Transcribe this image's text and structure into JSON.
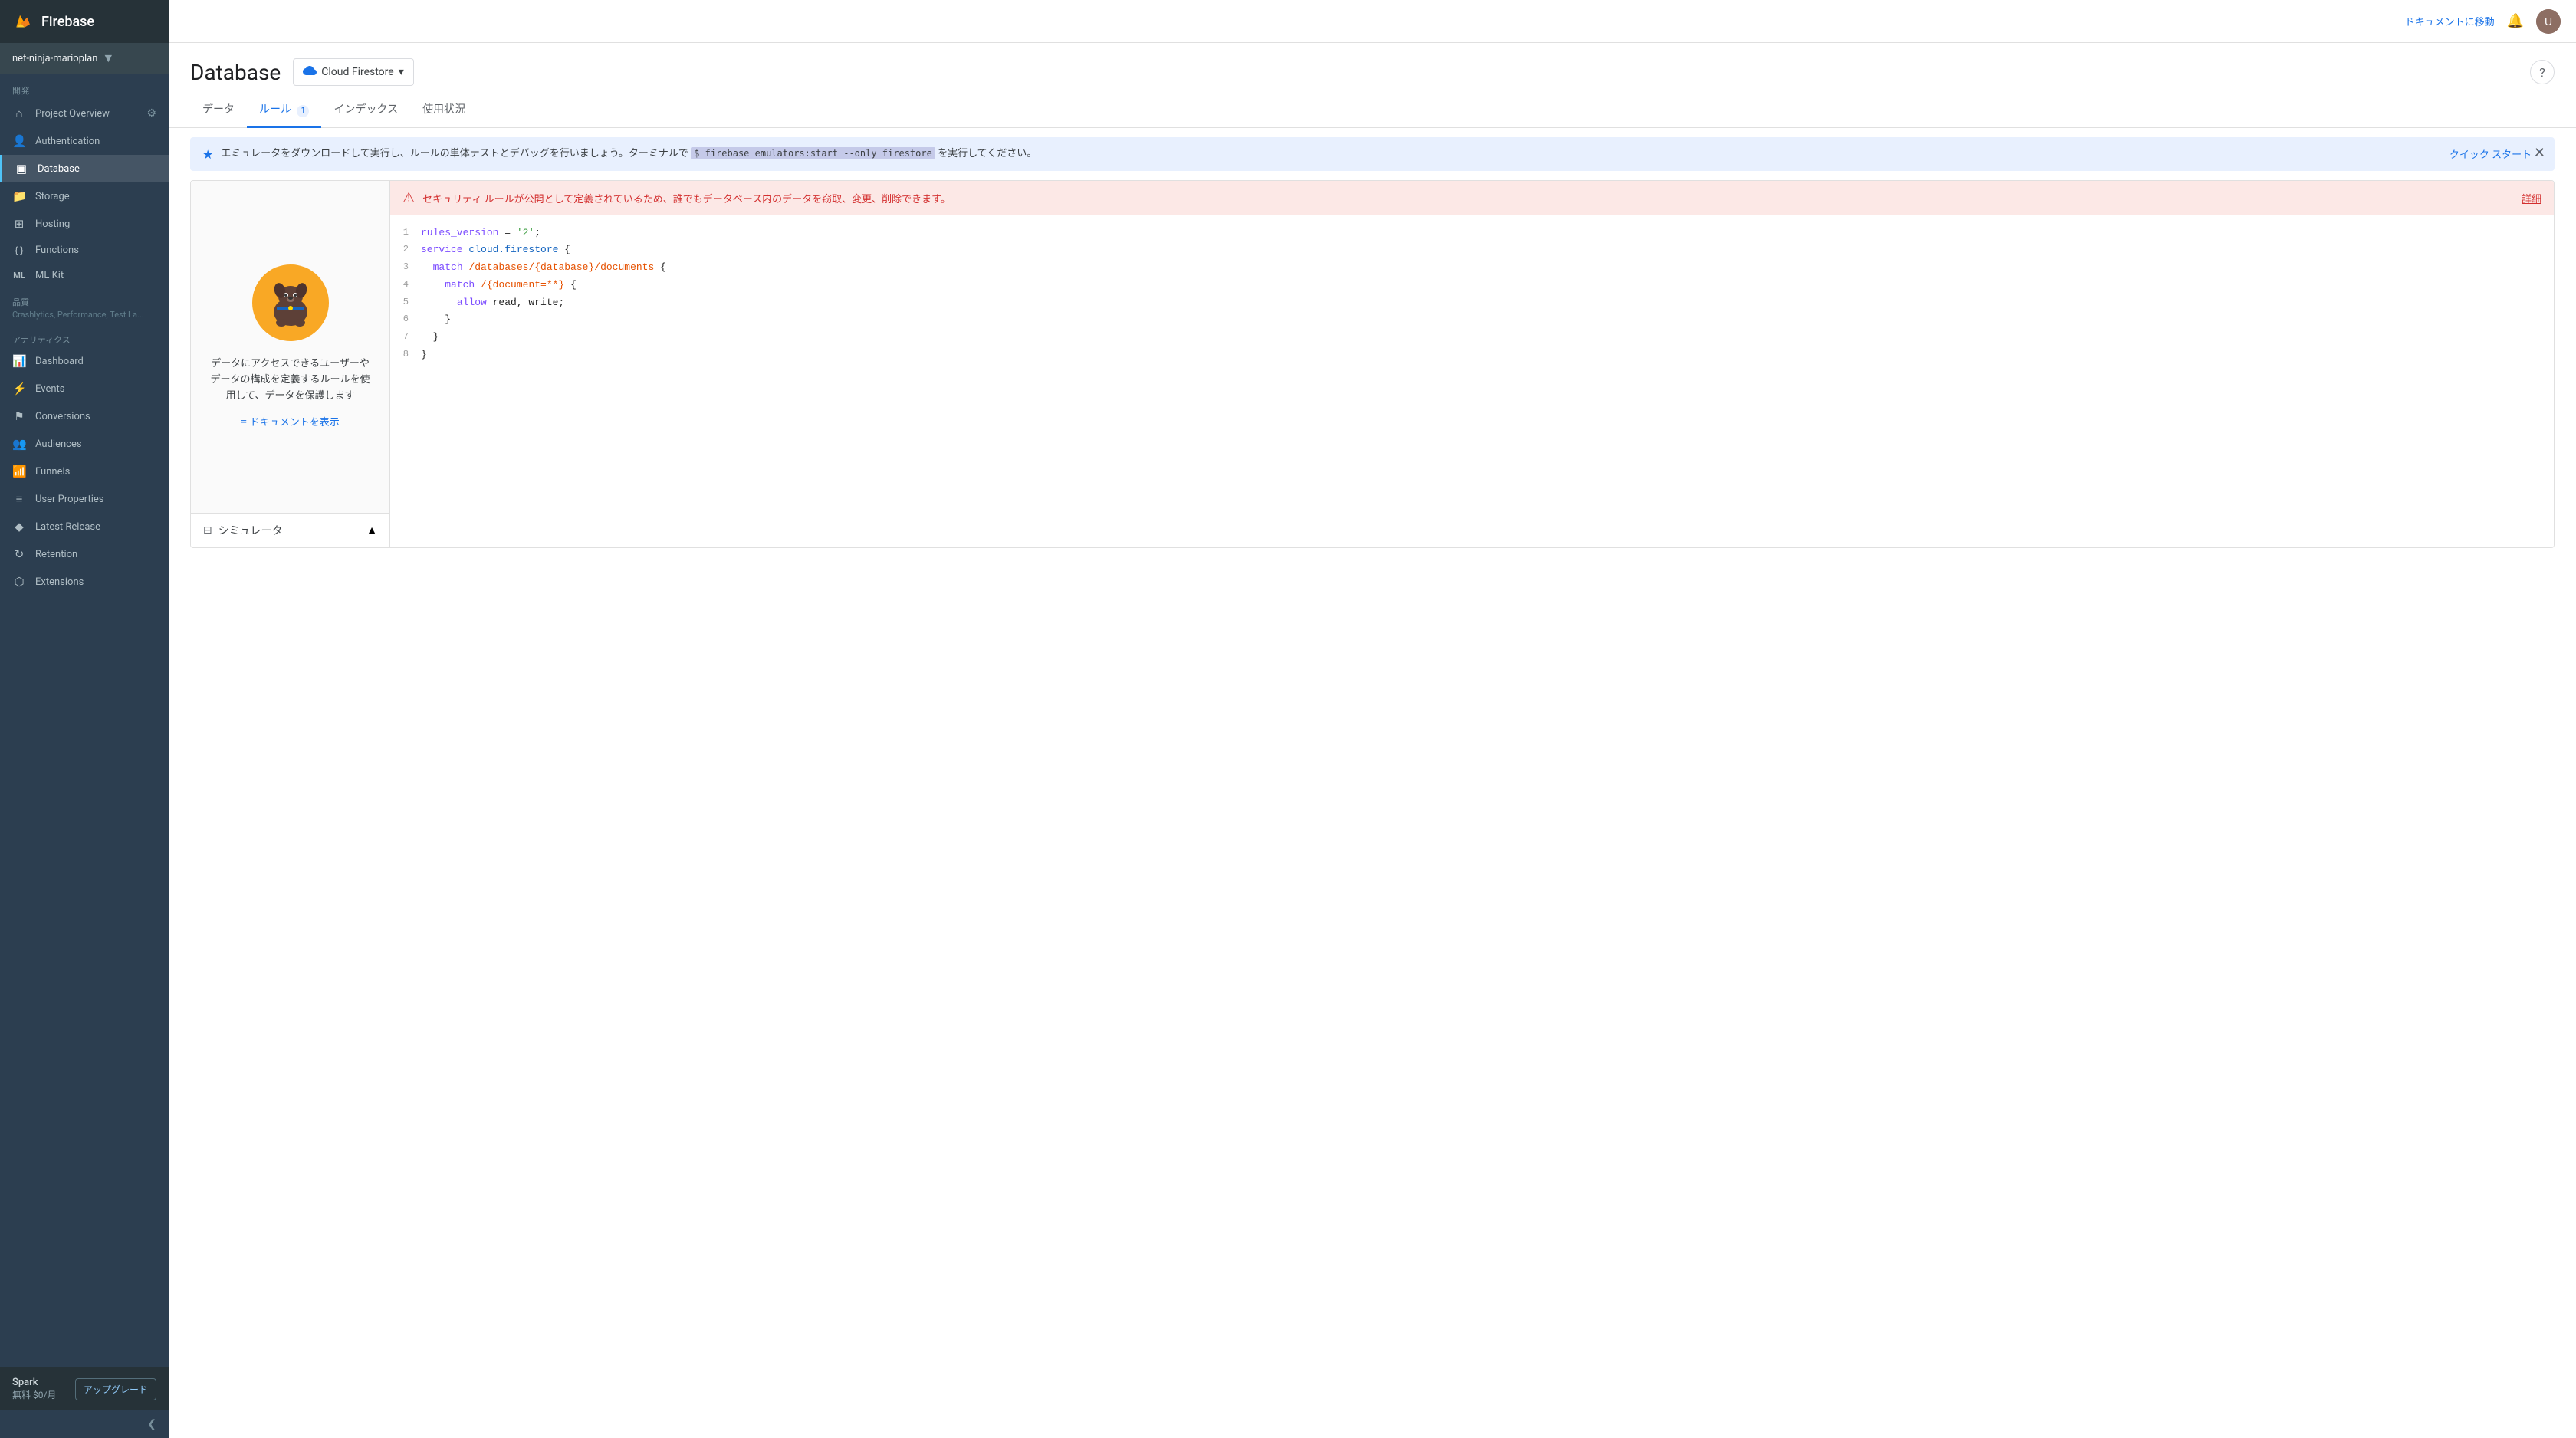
{
  "app": {
    "name": "Firebase",
    "logo_emoji": "🔥"
  },
  "project": {
    "name": "net-ninja-marioplan",
    "chevron": "▼"
  },
  "topbar": {
    "doc_link": "ドキュメントに移動",
    "notification_icon": "🔔",
    "avatar_text": "U"
  },
  "sidebar": {
    "dev_section": "開発",
    "items_dev": [
      {
        "id": "project-overview",
        "label": "Project Overview",
        "icon": "⊕"
      },
      {
        "id": "authentication",
        "label": "Authentication",
        "icon": "👤"
      },
      {
        "id": "database",
        "label": "Database",
        "icon": "▣",
        "active": true
      },
      {
        "id": "storage",
        "label": "Storage",
        "icon": "📁"
      },
      {
        "id": "hosting",
        "label": "Hosting",
        "icon": "⊞"
      },
      {
        "id": "functions",
        "label": "Functions",
        "icon": "{}"
      },
      {
        "id": "ml-kit",
        "label": "ML Kit",
        "icon": "ML"
      }
    ],
    "quality_section": "品質",
    "quality_sub": "Crashlytics, Performance, Test La...",
    "analytics_section": "アナリティクス",
    "items_analytics": [
      {
        "id": "dashboard",
        "label": "Dashboard",
        "icon": "📊"
      },
      {
        "id": "events",
        "label": "Events",
        "icon": "⚡"
      },
      {
        "id": "conversions",
        "label": "Conversions",
        "icon": "⚑"
      },
      {
        "id": "audiences",
        "label": "Audiences",
        "icon": "👥"
      },
      {
        "id": "funnels",
        "label": "Funnels",
        "icon": "📶"
      },
      {
        "id": "user-properties",
        "label": "User Properties",
        "icon": "≡"
      },
      {
        "id": "latest-release",
        "label": "Latest Release",
        "icon": "♦"
      },
      {
        "id": "retention",
        "label": "Retention",
        "icon": "↻"
      },
      {
        "id": "extensions",
        "label": "Extensions",
        "icon": "⬡"
      }
    ],
    "plan_name": "Spark",
    "plan_price": "無料 $0/月",
    "upgrade_label": "アップグレード",
    "collapse_icon": "❮"
  },
  "page": {
    "title": "Database",
    "db_selector": "Cloud Firestore",
    "db_icon": "☁",
    "help_icon": "?"
  },
  "tabs": [
    {
      "id": "data",
      "label": "データ",
      "active": false
    },
    {
      "id": "rules",
      "label": "ルール",
      "active": true,
      "badge": "1"
    },
    {
      "id": "indexes",
      "label": "インデックス",
      "active": false
    },
    {
      "id": "usage",
      "label": "使用状況",
      "active": false
    }
  ],
  "info_banner": {
    "text_before": "エミュレータをダウンロードして実行し、ルールの単体テストとデバッグを行いましょう。ターミナルで",
    "code": "$ firebase emulators:start --only firestore",
    "text_after": "を実行してください。",
    "quickstart": "クイック スタート",
    "close": "✕"
  },
  "rules_left": {
    "description": "データにアクセスできるユーザーやデータの構成を定義するルールを使用して、データを保護します",
    "doc_link": "ドキュメントを表示",
    "doc_icon": "≡"
  },
  "simulator": {
    "label": "シミュレータ",
    "icon": "⊟",
    "collapse": "▲"
  },
  "security_warning": {
    "icon": "⚠",
    "text": "セキュリティ ルールが公開として定義されているため、誰でもデータベース内のデータを窃取、変更、削除できます。",
    "detail_link": "詳細"
  },
  "code_editor": {
    "lines": [
      {
        "num": 1,
        "content": "rules_version = '2';"
      },
      {
        "num": 2,
        "content": "service cloud.firestore {"
      },
      {
        "num": 3,
        "content": "  match /databases/{database}/documents {"
      },
      {
        "num": 4,
        "content": "    match /{document=**} {"
      },
      {
        "num": 5,
        "content": "      allow read, write;"
      },
      {
        "num": 6,
        "content": "    }"
      },
      {
        "num": 7,
        "content": "  }"
      },
      {
        "num": 8,
        "content": "}"
      }
    ]
  }
}
